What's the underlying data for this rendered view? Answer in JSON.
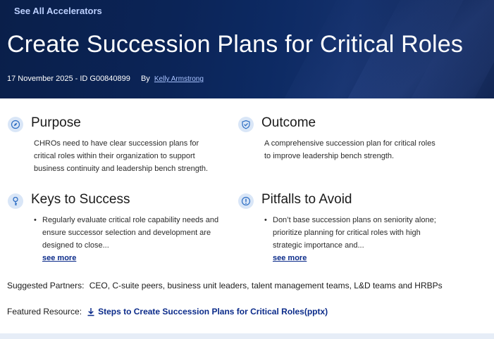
{
  "hero": {
    "back_link": "See All Accelerators",
    "title": "Create Succession Plans for Critical Roles",
    "date_id": "17 November 2025 - ID G00840899",
    "by_label": "By",
    "author": "Kelly Armstrong"
  },
  "cards": {
    "purpose": {
      "icon": "compass-icon",
      "title": "Purpose",
      "lines": [
        "CHROs need to have clear succession plans for",
        "critical roles within their organization to support",
        "business continuity and leadership bench strength."
      ]
    },
    "outcome": {
      "icon": "shield-check-icon",
      "title": "Outcome",
      "lines": [
        "A comprehensive succession plan for critical roles",
        "to improve leadership bench strength."
      ]
    },
    "keys": {
      "icon": "key-icon",
      "title": "Keys to Success",
      "bullet_lines": [
        "Regularly evaluate critical role capability needs and",
        "ensure successor selection and development are",
        "designed to close..."
      ],
      "see_more": "see more"
    },
    "pitfalls": {
      "icon": "alert-circle-icon",
      "title": "Pitfalls to Avoid",
      "bullet_lines": [
        "Don’t base succession plans on seniority alone;",
        "prioritize planning for critical roles with high",
        "strategic importance and..."
      ],
      "see_more": "see more"
    }
  },
  "partners": {
    "label": "Suggested Partners:",
    "value": "CEO, C-suite peers, business unit leaders, talent management teams, L&D teams and HRBPs"
  },
  "featured": {
    "label": "Featured Resource:",
    "icon": "download-icon",
    "link": "Steps to Create Succession Plans for Critical Roles(pptx)"
  },
  "colors": {
    "hero_bg": "#0b2457",
    "link": "#0b2b8a",
    "icon_bg": "#d9e6f7",
    "icon_fg": "#2f6fc4"
  }
}
